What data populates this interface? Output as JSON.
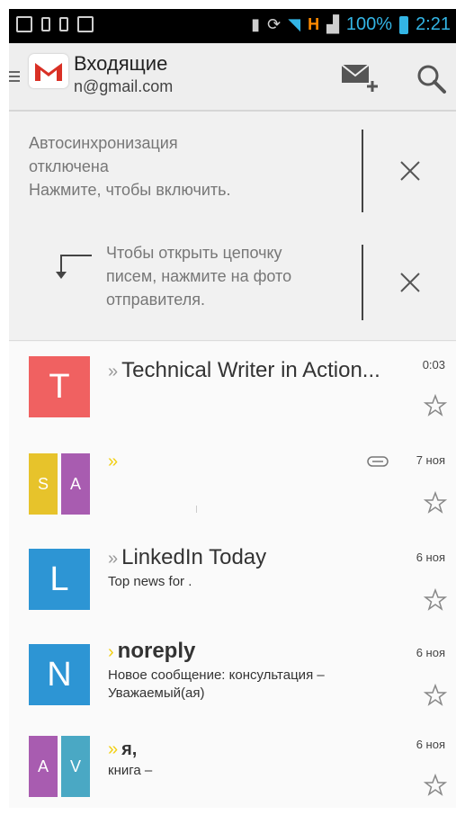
{
  "status_bar": {
    "network": "H",
    "battery": "100%",
    "time": "2:21"
  },
  "action_bar": {
    "title": "Входящие",
    "account": "n@gmail.com"
  },
  "cards": {
    "sync": {
      "line1": "Автосинхронизация",
      "line2": "отключена",
      "line3": "Нажмите, чтобы включить."
    },
    "tip": {
      "line1": "Чтобы открыть цепочку",
      "line2": "писем, нажмите на фото",
      "line3": "отправителя."
    }
  },
  "mails": [
    {
      "avatar": "T",
      "avatar_color": "#f06161",
      "mark": "»",
      "sender": "Technical Writer in Action...",
      "line1": "",
      "line2": "",
      "date": "0:03"
    },
    {
      "avatar_left": "S",
      "avatar_right": "A",
      "avatar_left_color": "#e7c32b",
      "avatar_right_color": "#a85cb0",
      "mark": "»",
      "sender": "",
      "line1": "",
      "line2": "",
      "date": "7 ноя"
    },
    {
      "avatar": "L",
      "avatar_color": "#2d95d4",
      "mark": "»",
      "sender": "LinkedIn Today",
      "line1": "Top news for .",
      "line2": "",
      "date": "6 ноя"
    },
    {
      "avatar": "N",
      "avatar_color": "#2d95d4",
      "mark": "›",
      "sender": "noreply",
      "line1": "Новое сообщение: консультация –",
      "line2": "Уважаемый(ая)",
      "date": "6 ноя"
    },
    {
      "avatar_left": "A",
      "avatar_right": "V",
      "avatar_left_color": "#a85cb0",
      "avatar_right_color": "#4aa8c4",
      "mark": "»",
      "sender": "я,",
      "line1": "книга –",
      "line2": "",
      "date": "6 ноя"
    }
  ],
  "colors": {
    "accent": "#33b5e5",
    "important_marker": "#f2cf12",
    "status_network": "#ff8a00"
  },
  "icons": {
    "menu": "menu-icon",
    "logo": "gmail-logo-icon",
    "compose": "compose-mail-icon",
    "search": "search-icon",
    "close": "close-icon",
    "tip_arrow": "arrow-down-left-icon",
    "attachment": "paperclip-icon",
    "star": "star-outline-icon"
  }
}
